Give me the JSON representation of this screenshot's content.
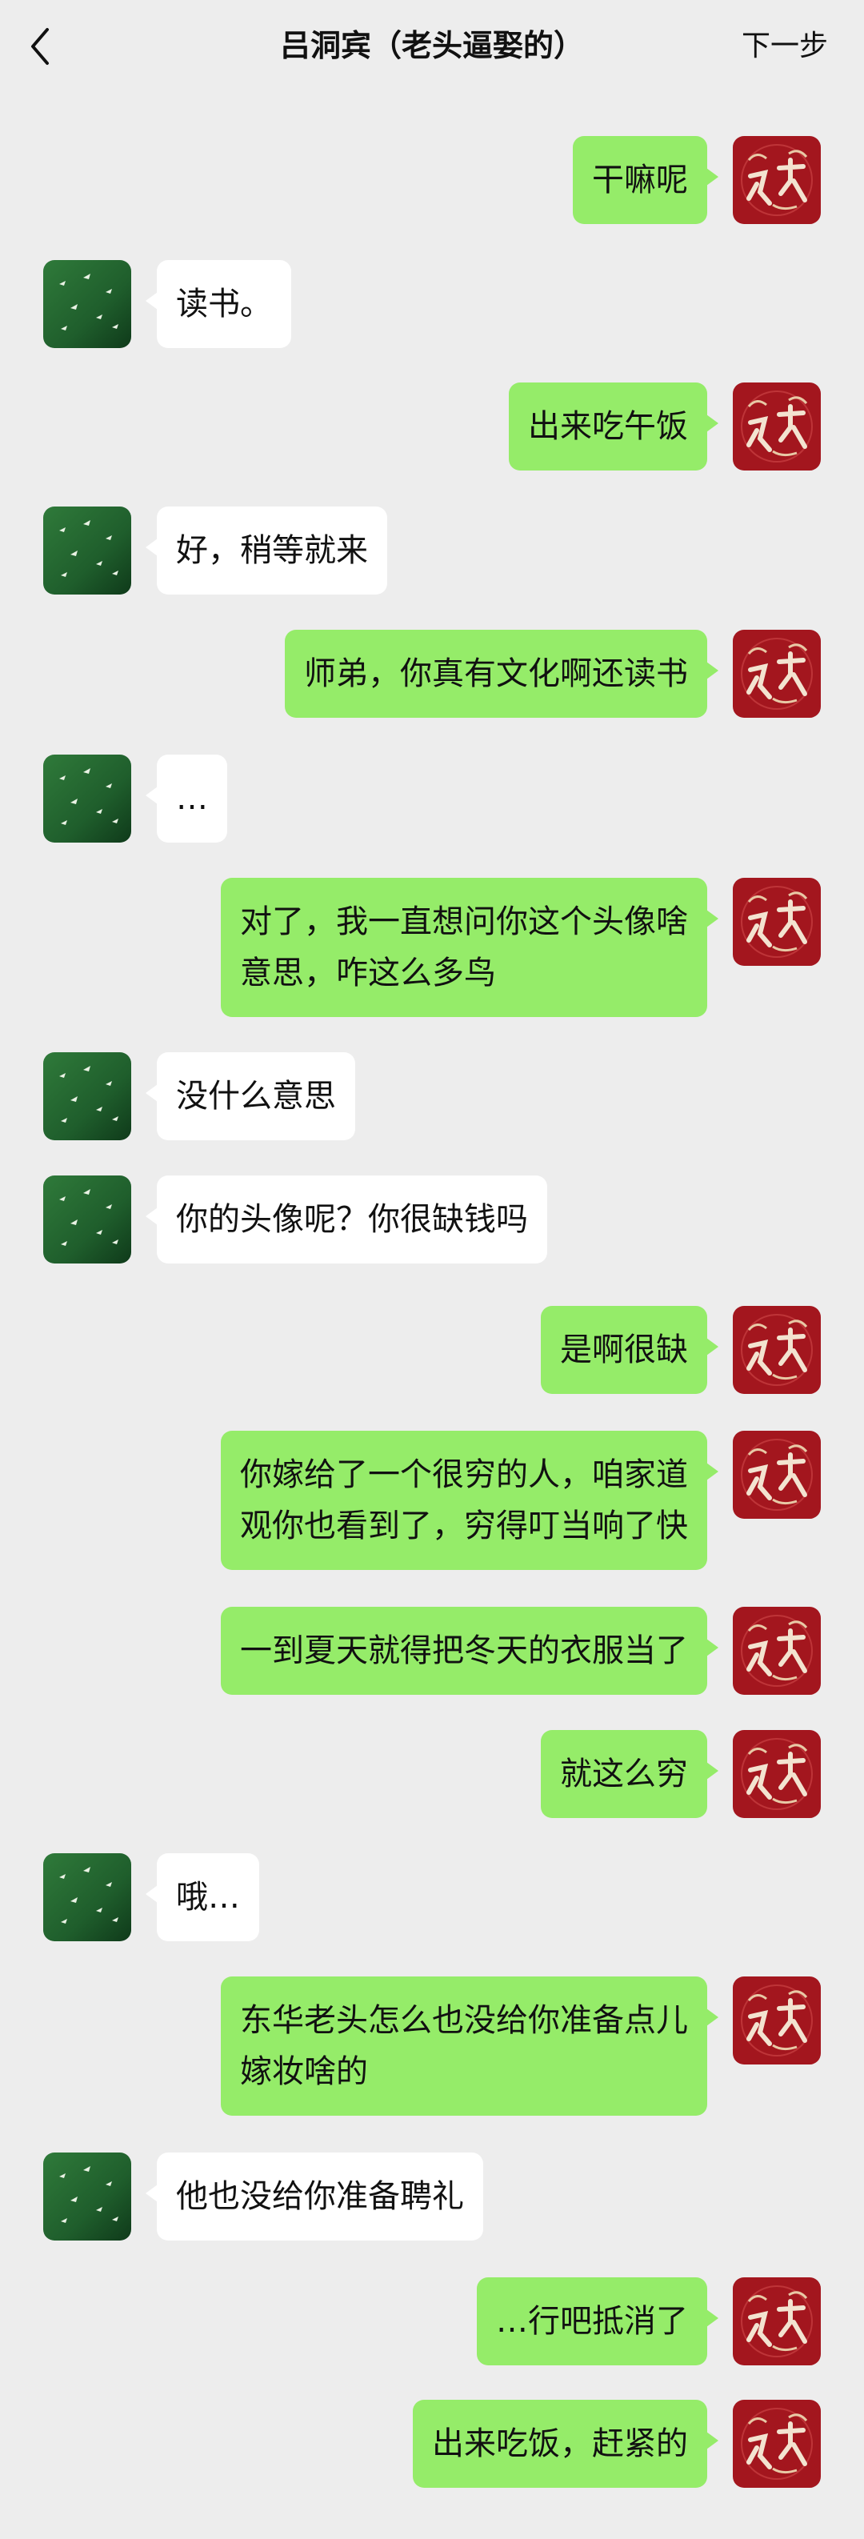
{
  "header": {
    "title": "吕洞宾（老头逼娶的）",
    "next_label": "下一步",
    "back_icon": "chevron-left-icon"
  },
  "colors": {
    "background": "#ededed",
    "self_bubble": "#95ec69",
    "other_bubble": "#ffffff",
    "self_avatar": "#a3161e",
    "other_avatar": "#1f5e2c"
  },
  "messages": [
    {
      "from": "self",
      "text": "干嘛呢"
    },
    {
      "from": "other",
      "text": "读书。"
    },
    {
      "from": "self",
      "text": "出来吃午饭"
    },
    {
      "from": "other",
      "text": "好，稍等就来"
    },
    {
      "from": "self",
      "text": "师弟，你真有文化啊还读书"
    },
    {
      "from": "other",
      "text": "…"
    },
    {
      "from": "self",
      "text": "对了，我一直想问你这个头像啥\n意思，咋这么多鸟"
    },
    {
      "from": "other",
      "text": "没什么意思"
    },
    {
      "from": "other",
      "text": "你的头像呢？你很缺钱吗"
    },
    {
      "from": "self",
      "text": "是啊很缺"
    },
    {
      "from": "self",
      "text": "你嫁给了一个很穷的人，咱家道\n观你也看到了，穷得叮当响了快"
    },
    {
      "from": "self",
      "text": "一到夏天就得把冬天的衣服当了"
    },
    {
      "from": "self",
      "text": "就这么穷"
    },
    {
      "from": "other",
      "text": "哦…"
    },
    {
      "from": "self",
      "text": "东华老头怎么也没给你准备点儿\n嫁妆啥的"
    },
    {
      "from": "other",
      "text": "他也没给你准备聘礼"
    },
    {
      "from": "self",
      "text": "…行吧抵消了"
    },
    {
      "from": "self",
      "text": "出来吃饭，赶紧的"
    }
  ]
}
